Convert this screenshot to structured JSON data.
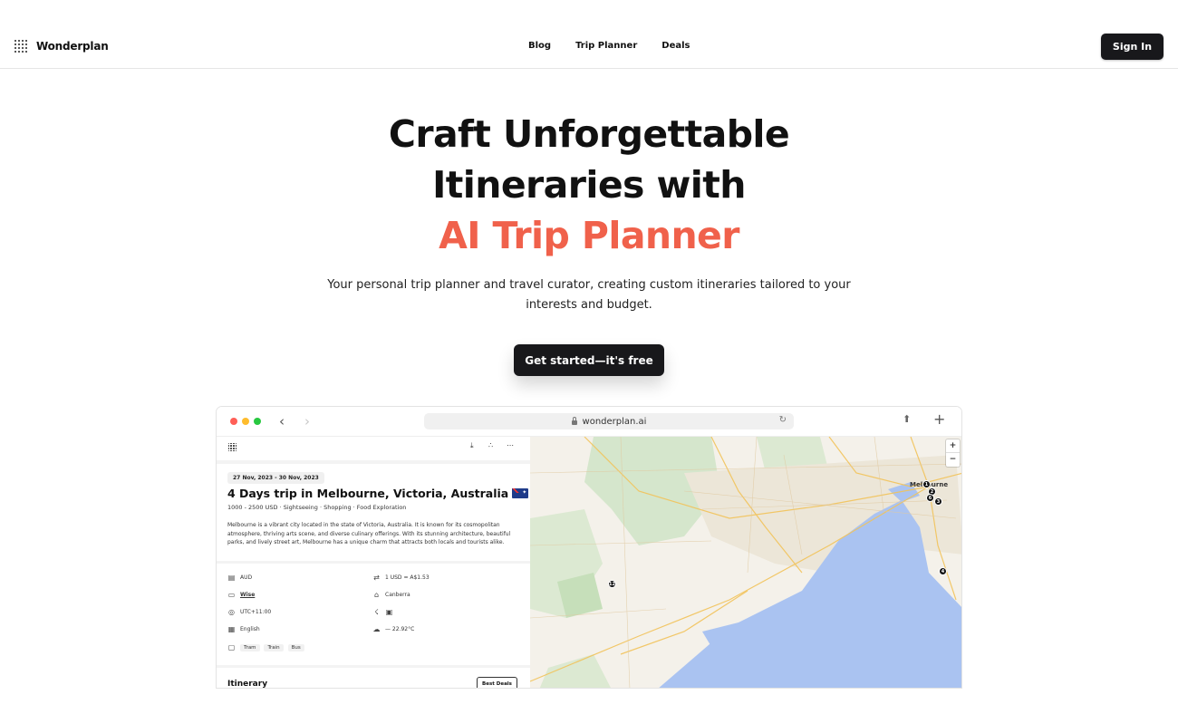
{
  "nav": {
    "brand": "Wonderplan",
    "links": [
      "Blog",
      "Trip Planner",
      "Deals"
    ],
    "signin": "Sign In"
  },
  "hero": {
    "line1": "Craft Unforgettable",
    "line2": "Itineraries with",
    "accent": "AI Trip Planner",
    "subtitle": "Your personal trip planner and travel curator, creating custom itineraries tailored to your interests and budget.",
    "cta": "Get started—it's free",
    "accent_color": "#f0614b"
  },
  "browser": {
    "url": "wonderplan.ai"
  },
  "trip": {
    "dates": "27 Nov, 2023 - 30 Nov, 2023",
    "title": "4 Days trip in Melbourne, Victoria, Australia",
    "meta": "1000 - 2500 USD · Sightseeing · Shopping · Food Exploration",
    "description": "Melbourne is a vibrant city located in the state of Victoria, Australia. It is known for its cosmopolitan atmosphere, thriving arts scene, and diverse culinary offerings. With its stunning architecture, beautiful parks, and lively street art, Melbourne has a unique charm that attracts both locals and tourists alike.",
    "currency": "AUD",
    "exchange": "1 USD = A$1.53",
    "payment": "Wise",
    "capital": "Canberra",
    "timezone": "UTC+11:00",
    "language": "English",
    "weather": "— 22.92°C",
    "transport": [
      "Tram",
      "Train",
      "Bus"
    ],
    "itinerary_heading": "Itinerary",
    "best_deals": "Best Deals"
  },
  "map": {
    "city_label": "Melbourne",
    "markers": [
      "1",
      "2",
      "3",
      "4",
      "6",
      "12"
    ],
    "zoom_in": "+",
    "zoom_out": "−"
  },
  "icons": {
    "share": "share-icon",
    "new_tab": "plus-icon",
    "download": "download-icon",
    "more": "more-icon"
  }
}
